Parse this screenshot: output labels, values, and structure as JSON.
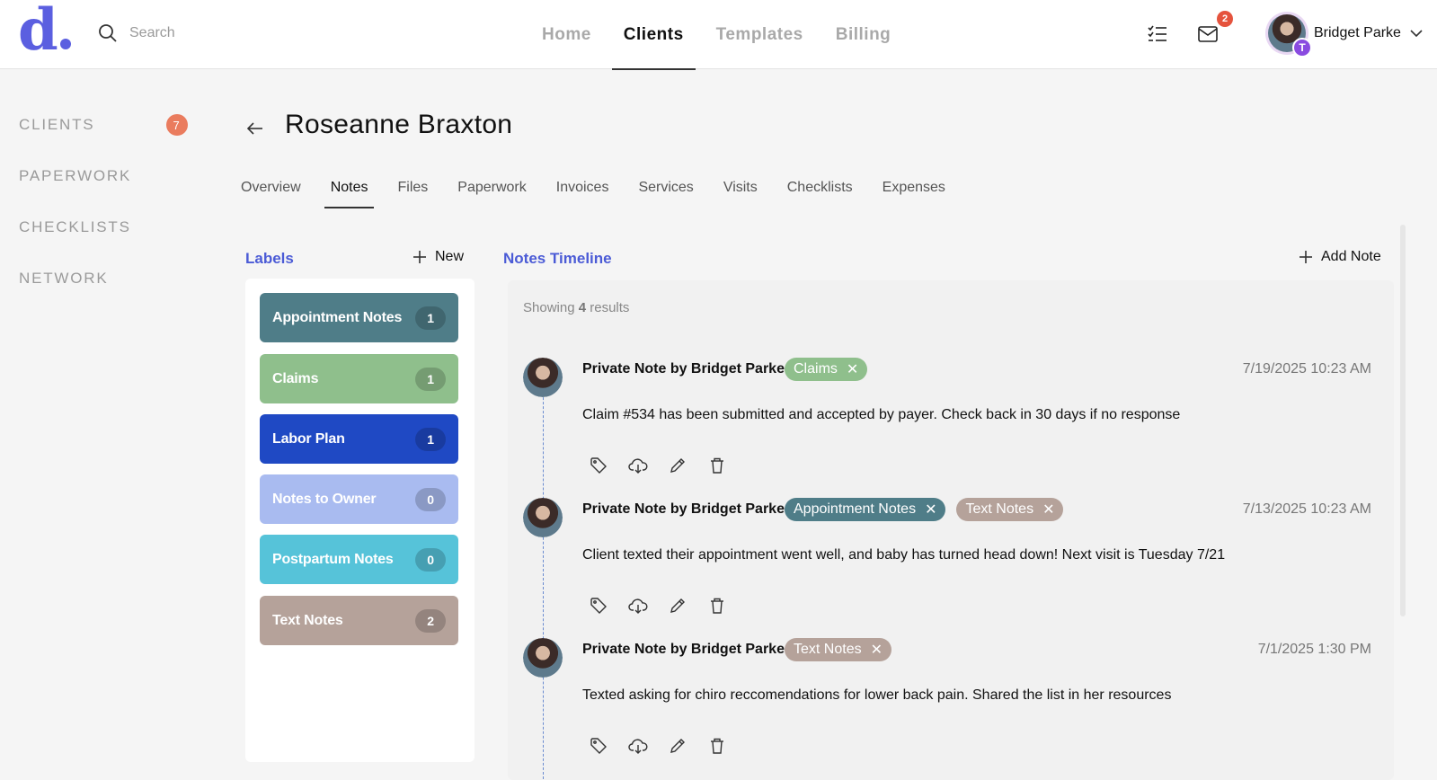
{
  "brand": {
    "logo_text": "d"
  },
  "search": {
    "placeholder": "Search"
  },
  "topnav": {
    "items": [
      "Home",
      "Clients",
      "Templates",
      "Billing"
    ],
    "active": "Clients"
  },
  "header": {
    "mail_count": "2",
    "user_name": "Bridget Parke",
    "user_initial": "T"
  },
  "sidebar": {
    "items": [
      {
        "label": "CLIENTS",
        "badge": "7"
      },
      {
        "label": "PAPERWORK"
      },
      {
        "label": "CHECKLISTS"
      },
      {
        "label": "NETWORK"
      }
    ]
  },
  "client": {
    "name": "Roseanne Braxton"
  },
  "tabs": [
    "Overview",
    "Notes",
    "Files",
    "Paperwork",
    "Invoices",
    "Services",
    "Visits",
    "Checklists",
    "Expenses"
  ],
  "labels": {
    "title": "Labels",
    "new_label": "New",
    "items": [
      {
        "name": "Appointment Notes",
        "count": "1",
        "color": "#4f7d88"
      },
      {
        "name": "Claims",
        "count": "1",
        "color": "#8fbf8c"
      },
      {
        "name": "Labor Plan",
        "count": "1",
        "color": "#1f49c4"
      },
      {
        "name": "Notes to Owner",
        "count": "0",
        "color": "#a9bbf0"
      },
      {
        "name": "Postpartum Notes",
        "count": "0",
        "color": "#56c3d9"
      },
      {
        "name": "Text Notes",
        "count": "2",
        "color": "#b5a29a"
      }
    ]
  },
  "notes": {
    "title": "Notes Timeline",
    "add_label": "Add Note",
    "showing_prefix": "Showing",
    "showing_count": "4",
    "showing_suffix": "results",
    "items": [
      {
        "author": "Private Note by Bridget Parke",
        "tags": [
          {
            "name": "Claims",
            "color": "#8fbf8c"
          }
        ],
        "date": "7/19/2025 10:23 AM",
        "body": "Claim #534 has been submitted and accepted by payer. Check back in 30 days if no response"
      },
      {
        "author": "Private Note by Bridget Parke",
        "tags": [
          {
            "name": "Appointment Notes",
            "color": "#4f7d88"
          },
          {
            "name": "Text Notes",
            "color": "#b5a29a"
          }
        ],
        "date": "7/13/2025 10:23 AM",
        "body": "Client texted their appointment went well, and baby has turned head down! Next visit is Tuesday 7/21"
      },
      {
        "author": "Private Note by Bridget Parke",
        "tags": [
          {
            "name": "Text Notes",
            "color": "#b5a29a"
          }
        ],
        "date": "7/1/2025 1:30 PM",
        "body": "Texted asking for chiro reccomendations for lower back pain. Shared the list in her resources"
      }
    ]
  },
  "icons": {
    "tag": "tag-icon",
    "download": "cloud-download-icon",
    "edit": "pencil-icon",
    "delete": "trash-icon"
  }
}
